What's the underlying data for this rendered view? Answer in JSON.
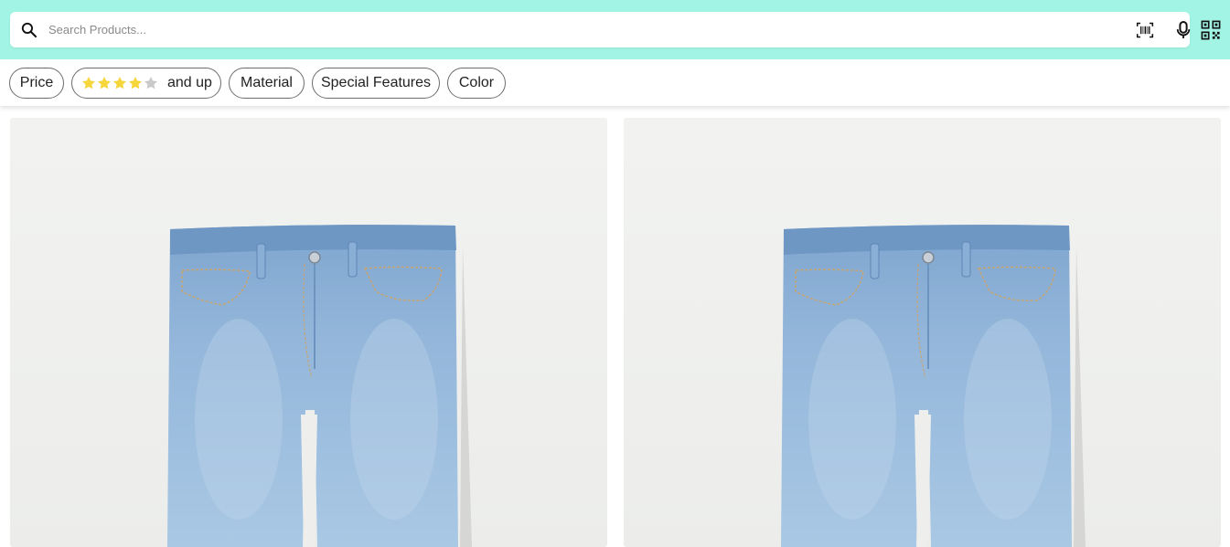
{
  "search": {
    "placeholder": "Search Products..."
  },
  "header_icons": {
    "search": "search-icon",
    "barcode": "barcode-scan-icon",
    "mic": "microphone-icon",
    "qr": "qr-code-icon"
  },
  "filters": {
    "price_label": "Price",
    "rating_label": "and up",
    "rating_value": 4,
    "rating_max": 5,
    "material_label": "Material",
    "special_features_label": "Special Features",
    "color_label": "Color"
  },
  "products": [
    {
      "image": "light-wash-jeans-image"
    },
    {
      "image": "light-wash-jeans-image"
    }
  ],
  "colors": {
    "header_background": "#a2f4e4",
    "star_filled": "#f7d63c",
    "star_empty": "#c9c9c9",
    "denim": "#8fb2d6"
  }
}
